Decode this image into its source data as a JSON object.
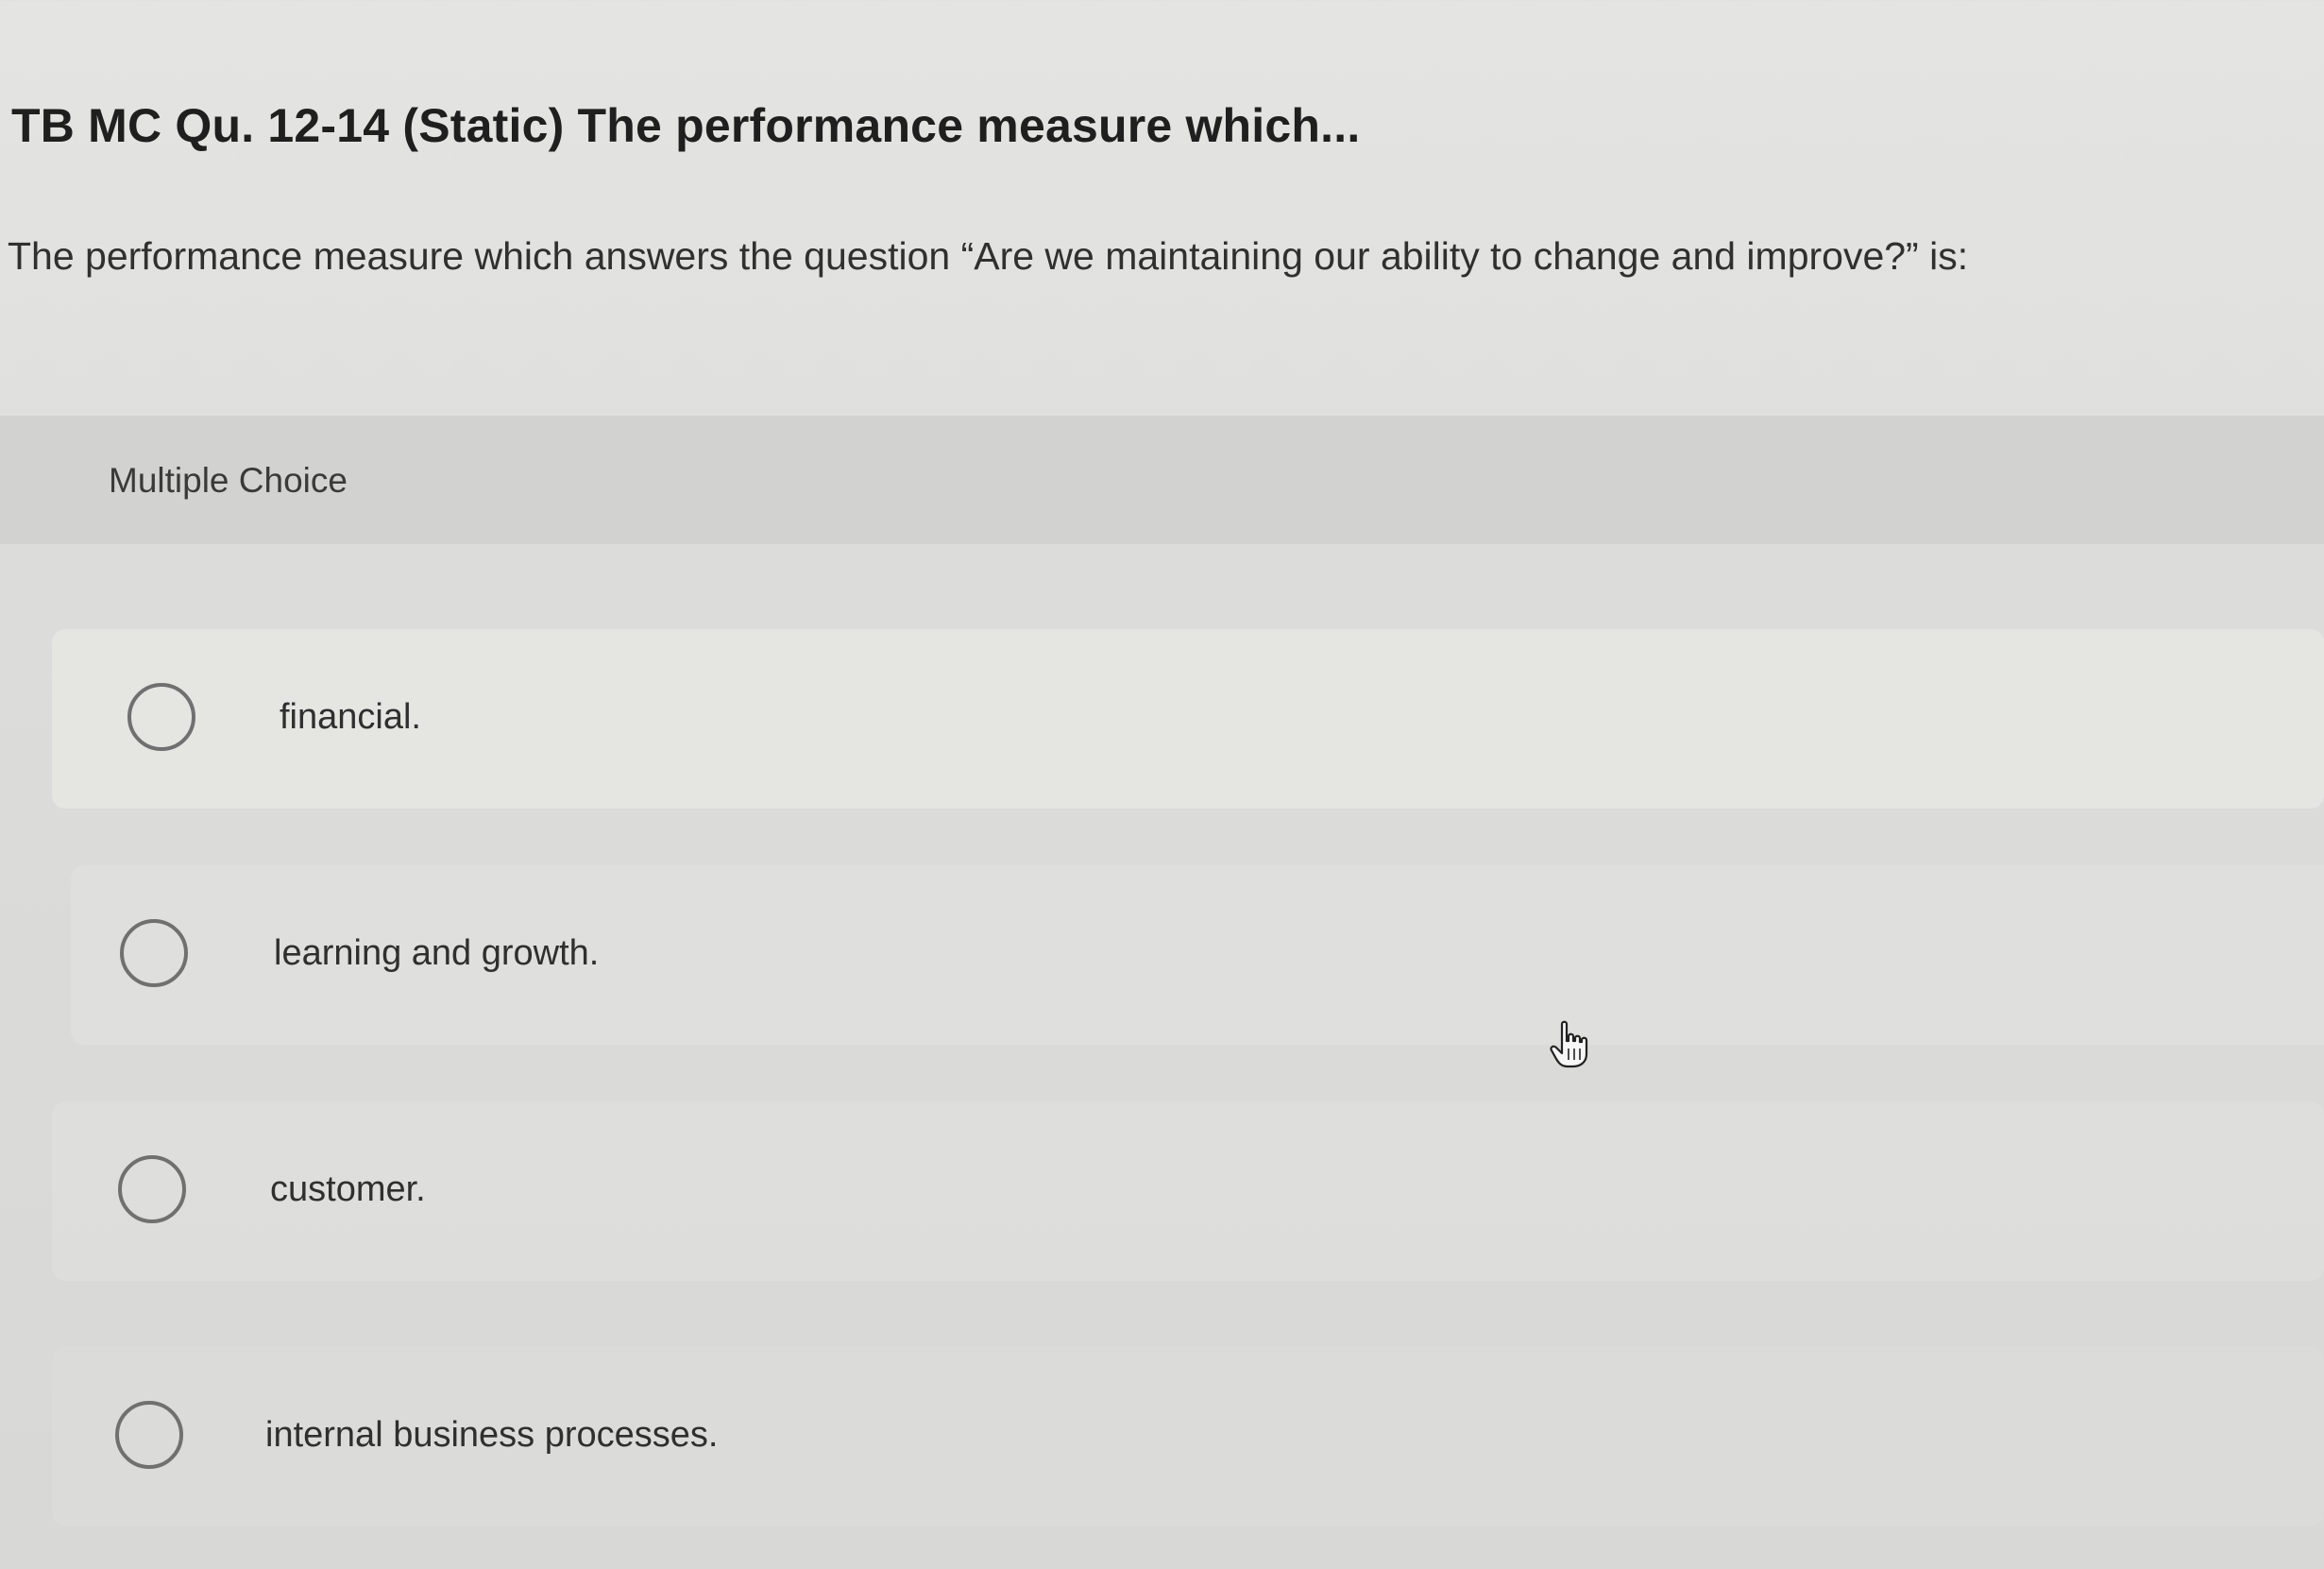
{
  "question": {
    "title": "TB MC Qu. 12-14 (Static) The performance measure which...",
    "text": "The performance measure which answers the question “Are we maintaining our ability to change and improve?” is:"
  },
  "answer_section": {
    "type_label": "Multiple Choice",
    "options": [
      {
        "label": "financial.",
        "selected": false
      },
      {
        "label": "learning and growth.",
        "selected": false
      },
      {
        "label": "customer.",
        "selected": false
      },
      {
        "label": "internal business processes.",
        "selected": false
      }
    ]
  },
  "pointer": {
    "icon": "hand-pointer-icon"
  }
}
